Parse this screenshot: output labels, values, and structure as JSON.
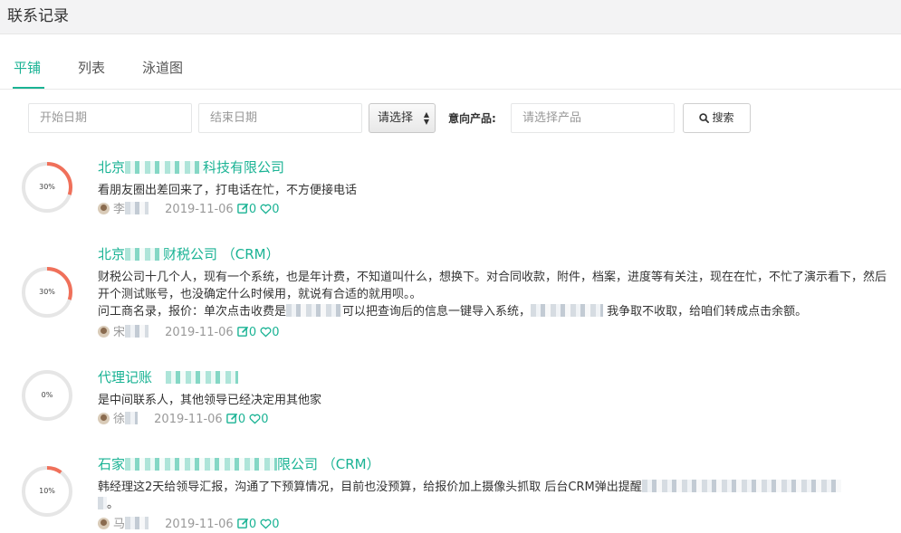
{
  "header": {
    "title": "联系记录"
  },
  "tabs": [
    {
      "label": "平铺"
    },
    {
      "label": "列表"
    },
    {
      "label": "泳道图"
    }
  ],
  "filters": {
    "start_date_placeholder": "开始日期",
    "end_date_placeholder": "结束日期",
    "select_value": "请选择",
    "product_label": "意向产品:",
    "product_placeholder": "请选择产品",
    "search_label": "搜索"
  },
  "colors": {
    "accent": "#1ab394",
    "ring_progress": "#f0705a",
    "ring_track": "#e6e6e6"
  },
  "records": [
    {
      "company_pre": "北京",
      "company_post": "科技有限公司",
      "progress_label": "30%",
      "progress": 0.3,
      "desc1": "看朋友圈出差回来了，打电话在忙，不方便接电话",
      "user": "李",
      "date": "2019-11-06",
      "edits": "0",
      "likes": "0"
    },
    {
      "company_pre": "北京",
      "company_post": "财税公司 （CRM）",
      "progress_label": "30%",
      "progress": 0.3,
      "desc1": "财税公司十几个人，现有一个系统，也是年计费，不知道叫什么，想换下。对合同收款，附件，档案，进度等有关注，现在在忙，不忙了演示看下，然后开个测试账号，也没确定什么时候用，就说有合适的就用呗。。",
      "desc2_pre": "问工商名录，报价：单次点击收费是",
      "desc2_mid": "可以把查询后的信息一键导入系统，",
      "desc2_post": "我争取不收取，给咱们转成点击余额。",
      "user": "宋",
      "date": "2019-11-06",
      "edits": "0",
      "likes": "0"
    },
    {
      "company_pre": "代理记账",
      "company_post": "",
      "progress_label": "0%",
      "progress": 0,
      "desc1": "是中间联系人，其他领导已经决定用其他家",
      "user": "徐",
      "date": "2019-11-06",
      "edits": "0",
      "likes": "0"
    },
    {
      "company_pre": "石家",
      "company_post": "限公司 （CRM）",
      "progress_label": "10%",
      "progress": 0.1,
      "desc1": "韩经理这2天给领导汇报，沟通了下预算情况，目前也没预算，给报价加上摄像头抓取 后台CRM弹出提醒",
      "desc1_tail": "。",
      "user": "马",
      "date": "2019-11-06",
      "edits": "0",
      "likes": "0"
    }
  ]
}
